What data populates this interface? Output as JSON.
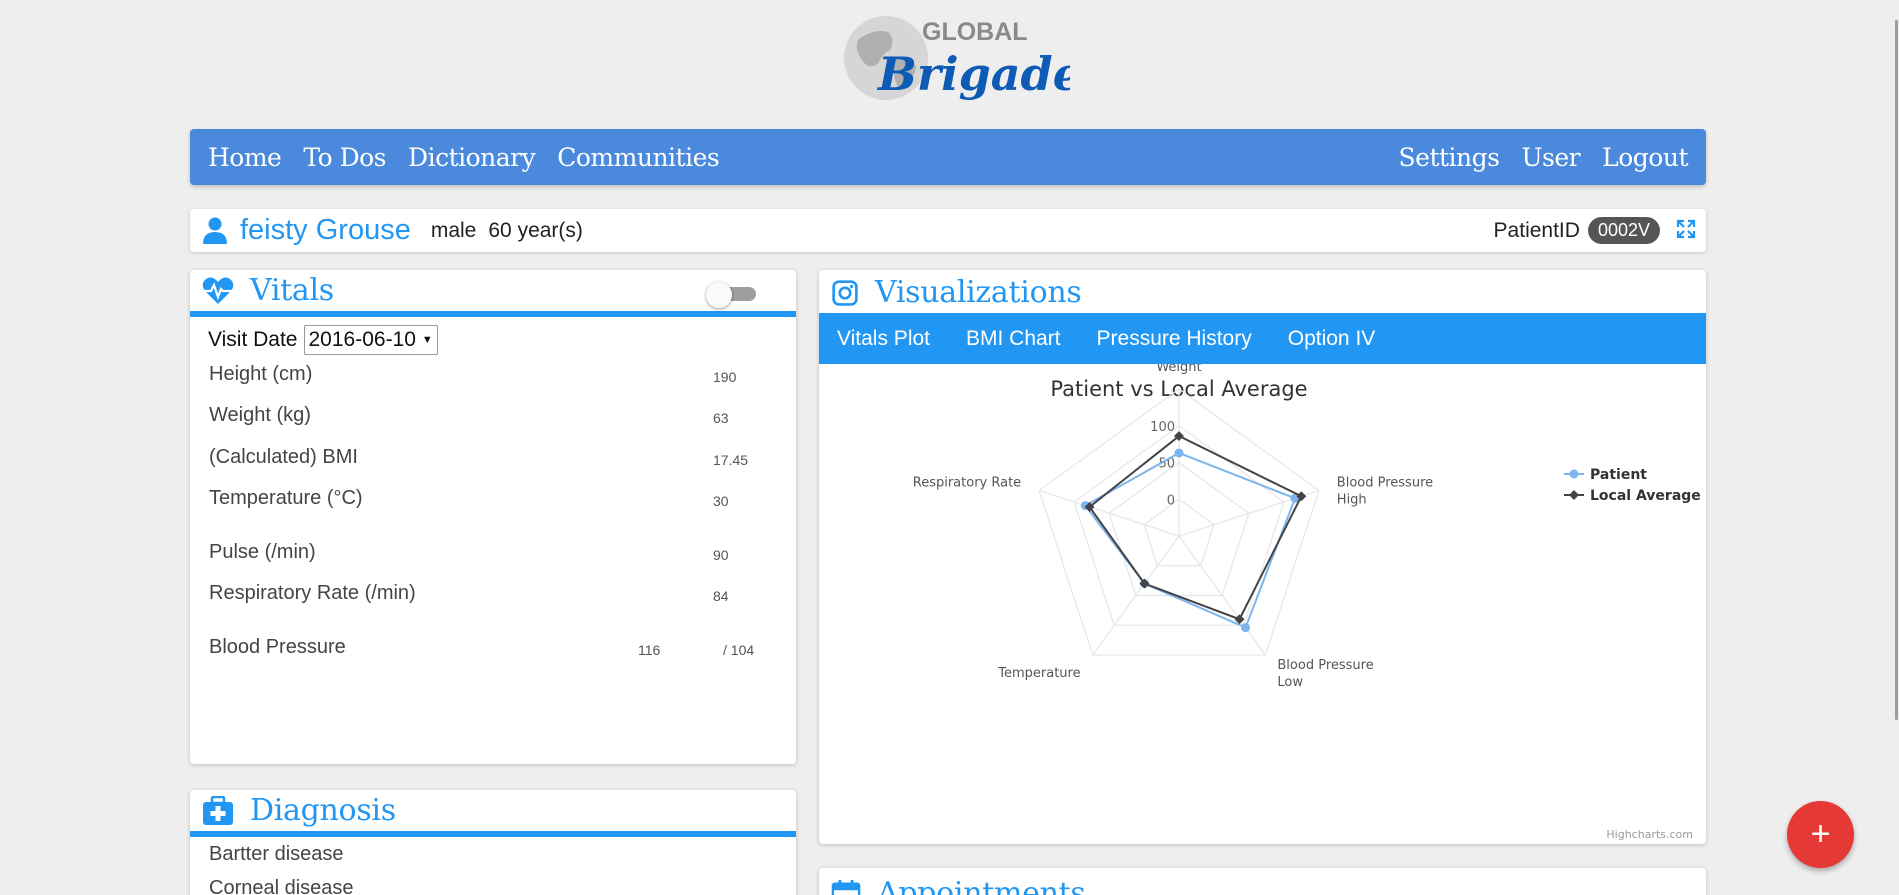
{
  "logo": {
    "line1": "GLOBAL",
    "line2": "Brigades"
  },
  "nav": {
    "left": [
      "Home",
      "To Dos",
      "Dictionary",
      "Communities"
    ],
    "right": [
      "Settings",
      "User",
      "Logout"
    ]
  },
  "patient": {
    "name": "feisty Grouse",
    "gender": "male",
    "age": "60 year(s)",
    "id_label": "PatientID",
    "id": "0002V"
  },
  "vitals": {
    "title": "Vitals",
    "visit_label": "Visit Date",
    "visit_date": "2016-06-10",
    "height_label": "Height (cm)",
    "height": "190",
    "weight_label": "Weight (kg)",
    "weight": "63",
    "bmi_label": "(Calculated) BMI",
    "bmi": "17.45",
    "temp_label": "Temperature (°C)",
    "temp": "30",
    "pulse_label": "Pulse (/min)",
    "pulse": "90",
    "resp_label": "Respiratory Rate (/min)",
    "resp": "84",
    "bp_label": "Blood Pressure",
    "bp_high": "116",
    "bp_low": "/ 104"
  },
  "diagnosis": {
    "title": "Diagnosis",
    "items": [
      "Bartter disease",
      "Corneal disease"
    ]
  },
  "visualizations": {
    "title": "Visualizations",
    "tabs": [
      "Vitals Plot",
      "BMI Chart",
      "Pressure History",
      "Option IV"
    ]
  },
  "appointments": {
    "title": "Appointments"
  },
  "fab": {
    "label": "+"
  },
  "chart_data": {
    "type": "radar",
    "title": "Patient vs Local Average",
    "categories": [
      "Weight",
      "Blood Pressure High",
      "Blood Pressure Low",
      "Temperature",
      "Respiratory Rate"
    ],
    "category_lines": [
      [
        "Weight"
      ],
      [
        "Blood Pressure",
        "High"
      ],
      [
        "Blood Pressure",
        "Low"
      ],
      [
        "Temperature"
      ],
      [
        "Respiratory Rate"
      ]
    ],
    "series": [
      {
        "name": "Patient",
        "color": "#7cb5ec",
        "values": [
          63,
          116,
          104,
          30,
          84
        ]
      },
      {
        "name": "Local Average",
        "color": "#434348",
        "values": [
          86,
          125,
          90,
          30,
          78
        ]
      }
    ],
    "ticks": [
      0,
      50,
      100
    ],
    "ymin": -50,
    "ymax": 150,
    "credit": "Highcharts.com",
    "legend_position": "top-right"
  }
}
